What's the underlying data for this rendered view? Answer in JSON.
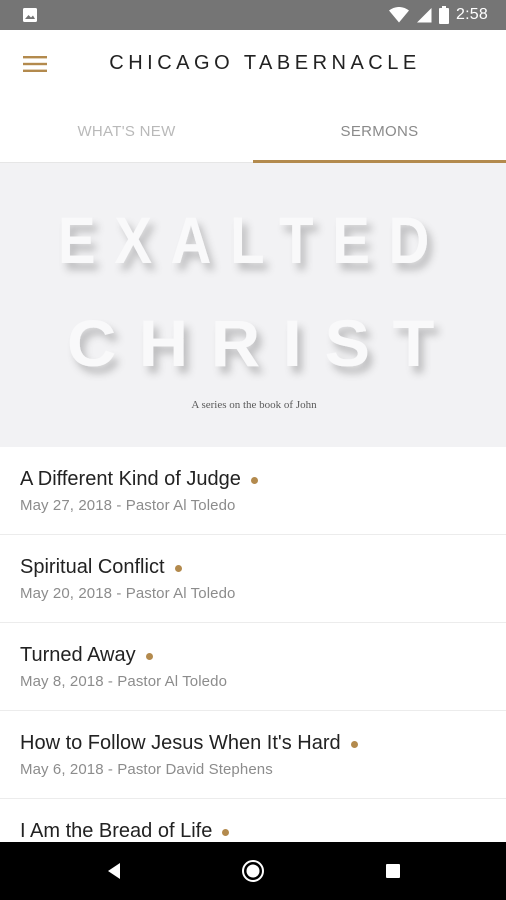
{
  "status_bar": {
    "time": "2:58",
    "icons": [
      "image-icon",
      "wifi-icon",
      "signal-icon",
      "battery-icon"
    ],
    "background": "#757575"
  },
  "header": {
    "title": "CHICAGO TABERNACLE",
    "menu_icon": "hamburger-menu-icon"
  },
  "tabs": [
    {
      "label": "WHAT'S NEW",
      "active": false
    },
    {
      "label": "SERMONS",
      "active": true
    }
  ],
  "hero": {
    "line1": "EXALTED",
    "line2": "CHRIST",
    "subtitle": "A series on the book of John"
  },
  "sermons": [
    {
      "title": "A Different Kind of Judge",
      "meta": "May 27, 2018 - Pastor Al Toledo"
    },
    {
      "title": "Spiritual Conflict",
      "meta": "May 20, 2018 - Pastor Al Toledo"
    },
    {
      "title": "Turned Away",
      "meta": "May 8, 2018 - Pastor Al Toledo"
    },
    {
      "title": "How to Follow Jesus When It's Hard",
      "meta": "May 6, 2018 - Pastor David Stephens"
    },
    {
      "title": "I Am the Bread of Life",
      "meta": ""
    }
  ],
  "nav_bar": {
    "buttons": [
      "back-icon",
      "home-icon",
      "recents-icon"
    ]
  },
  "colors": {
    "accent": "#b38a4d",
    "title_text": "#222222",
    "meta_text": "#8c8c8c",
    "hero_background": "#f2f2f4"
  }
}
